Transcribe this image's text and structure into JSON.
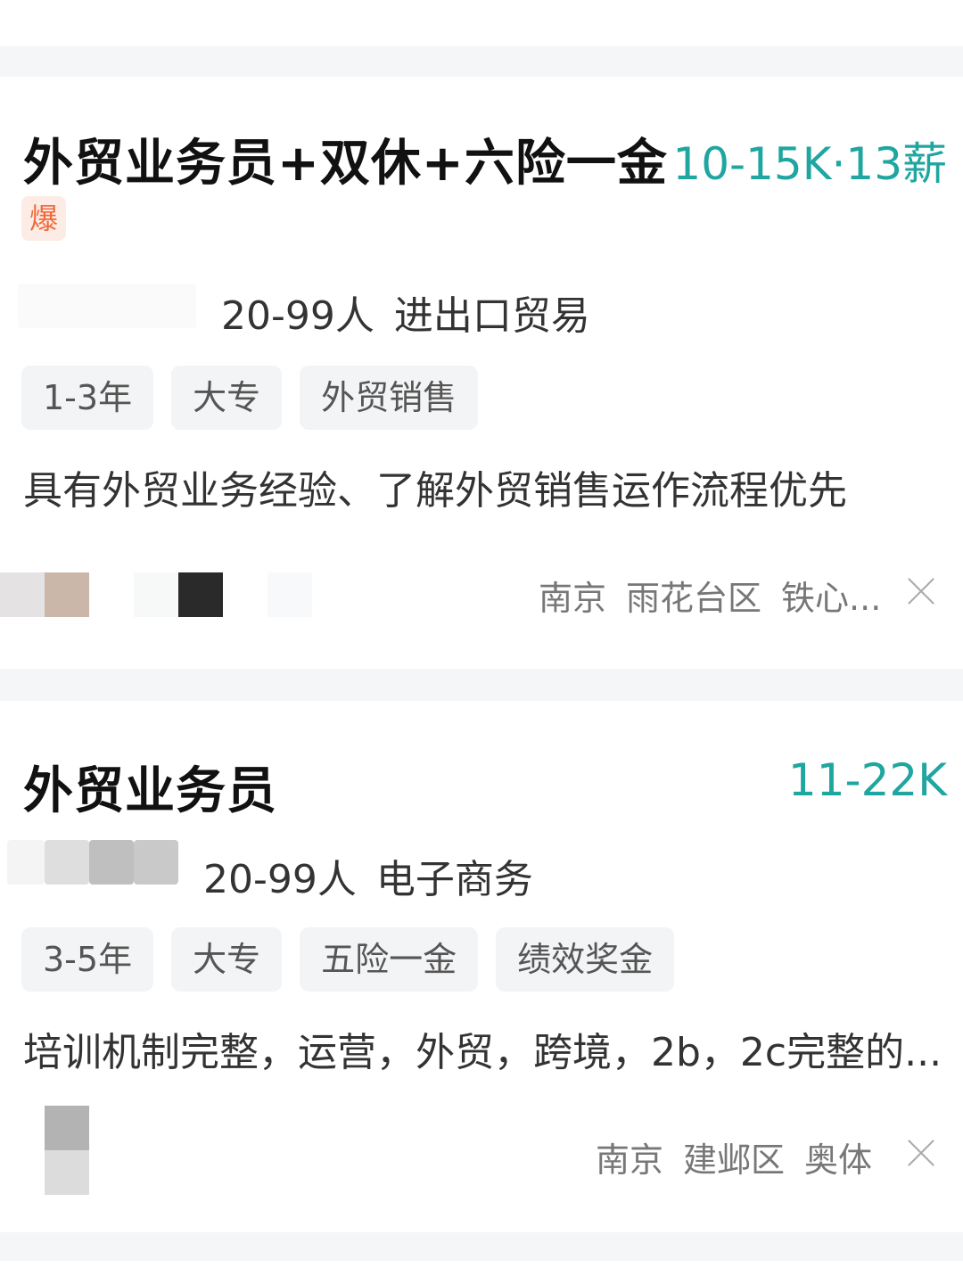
{
  "jobs": [
    {
      "title": "外贸业务员+双休+六险一金",
      "salary": "10-15K·13薪",
      "badge": "爆",
      "company": {
        "size": "20-99人",
        "industry": "进出口贸易"
      },
      "tags": [
        "1-3年",
        "大专",
        "外贸销售"
      ],
      "description": "具有外贸业务经验、了解外贸销售运作流程优先",
      "location": {
        "city": "南京",
        "district": "雨花台区",
        "area": "铁心..."
      }
    },
    {
      "title": "外贸业务员",
      "salary": "11-22K",
      "company": {
        "size": "20-99人",
        "industry": "电子商务"
      },
      "tags": [
        "3-5年",
        "大专",
        "五险一金",
        "绩效奖金"
      ],
      "description": "培训机制完整，运营，外贸，跨境，2b，2c完整的...",
      "location": {
        "city": "南京",
        "district": "建邺区",
        "area": "奥体"
      }
    }
  ],
  "colors": {
    "salary": "#1fa6a0",
    "badge_text": "#ef6a3b",
    "badge_bg": "#fdece6"
  },
  "icons": {
    "dismiss": "close-icon"
  }
}
